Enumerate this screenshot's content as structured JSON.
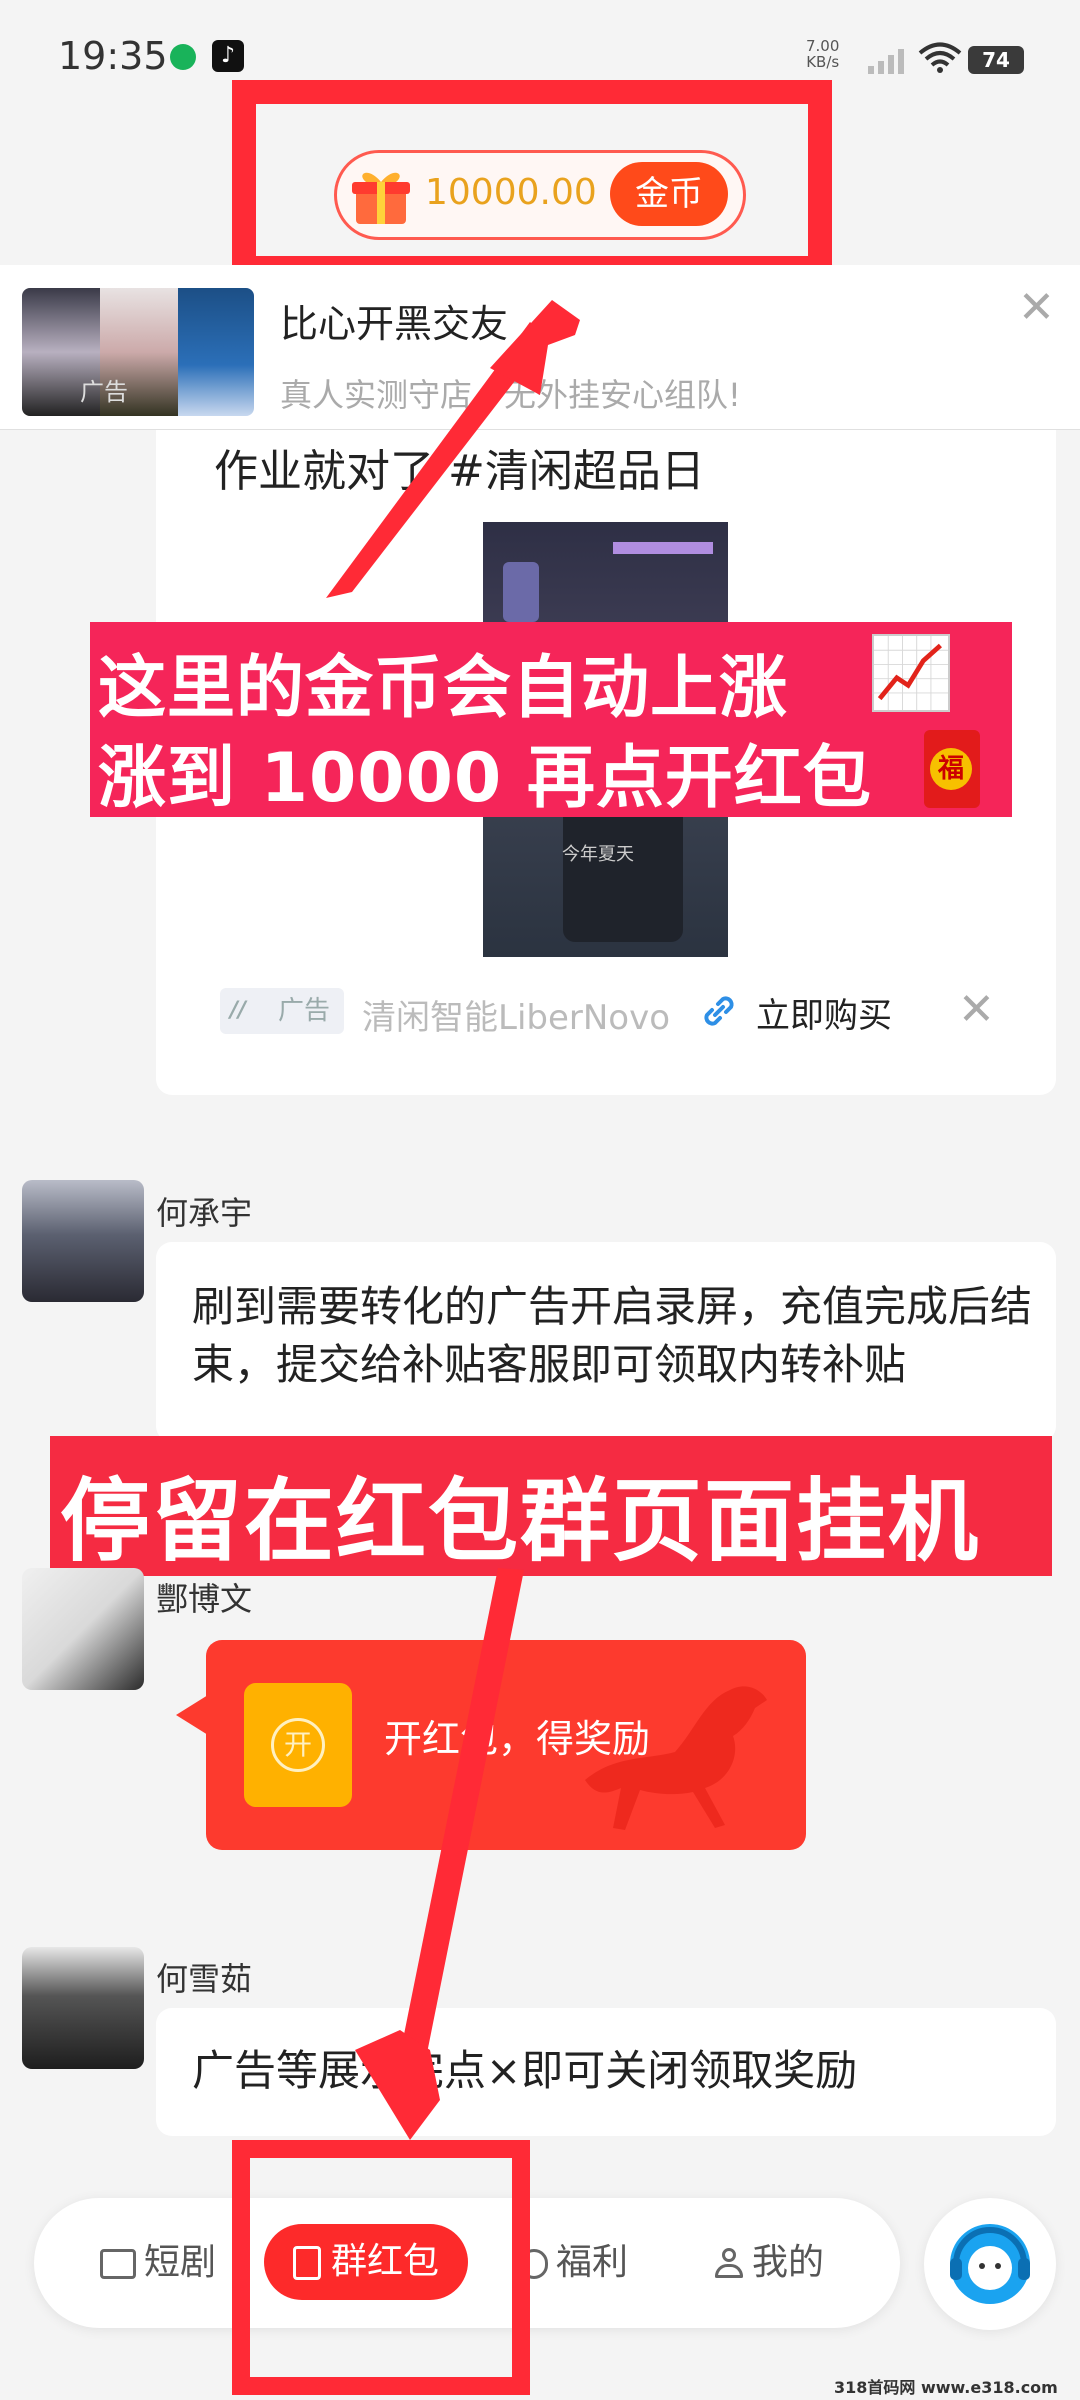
{
  "status_bar": {
    "time": "19:35",
    "net_speed_value": "7.00",
    "net_speed_unit": "KB/s",
    "battery": "74"
  },
  "coin": {
    "amount": "10000.00",
    "button_label": "金币"
  },
  "top_ad": {
    "title": "比心开黑交友",
    "subtitle": "真人实测守店，无外挂安心组队!",
    "ad_label": "广告"
  },
  "ad_card": {
    "text": "作业就对了 #清闲超品日",
    "video_caption": "今年夏天",
    "tag": "广告",
    "brand": "清闲智能LiberNovo",
    "buy_label": "立即购买"
  },
  "annotation_1": {
    "line1": "这里的金币会自动上涨",
    "line2": "涨到 10000 再点开红包",
    "fu_char": "福"
  },
  "annotation_2": {
    "text": "停留在红包群页面挂机"
  },
  "messages": [
    {
      "sender": "何承宇",
      "text": "刷到需要转化的广告开启录屏，充值完成后结束，提交给补贴客服即可领取内转补贴"
    },
    {
      "sender": "酆博文",
      "red_packet_label": "开红包，得奖励",
      "red_packet_icon_char": "开"
    },
    {
      "sender": "何雪茹",
      "text": "广告等展示完点×即可关闭领取奖励"
    }
  ],
  "nav": {
    "items": [
      {
        "label": "短剧"
      },
      {
        "label": "群红包"
      },
      {
        "label": "福利"
      },
      {
        "label": "我的"
      }
    ]
  },
  "watermark": "318首码网 www.e318.com",
  "colors": {
    "annotation_red": "#f52559",
    "highlight_red": "#ff2a36",
    "coin_button": "#ff4a1a",
    "coin_amount": "#e9a21d",
    "red_packet": "#fd3a2e",
    "red_packet_icon": "#ffb100",
    "support_blue": "#1aa3f0"
  }
}
